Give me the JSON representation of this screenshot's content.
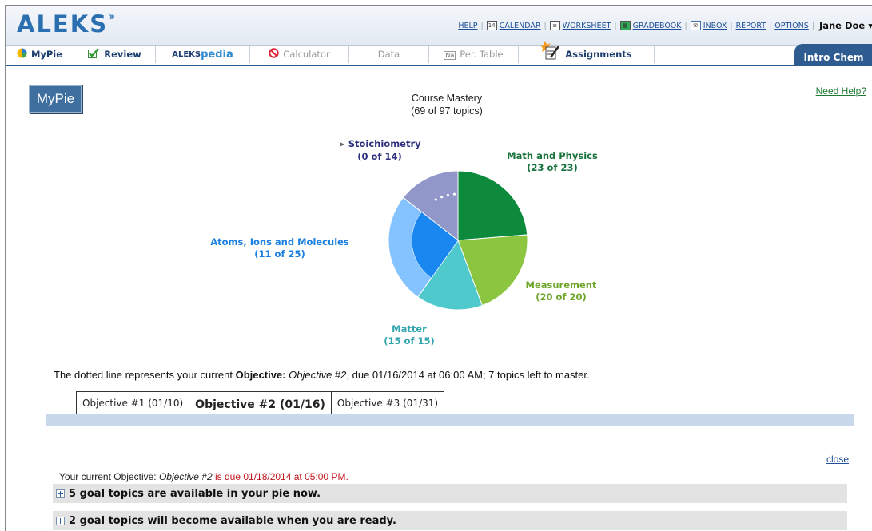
{
  "header": {
    "logo": "ALEKS",
    "logo_mark": "®",
    "links": [
      "HELP",
      "CALENDAR",
      "WORKSHEET",
      "GRADEBOOK",
      "INBOX",
      "REPORT",
      "OPTIONS"
    ],
    "calendar_icon_text": "14",
    "user": "Jane Doe ▾"
  },
  "nav": {
    "tabs": [
      "MyPie",
      "Review",
      "ALEKSpedia",
      "Calculator",
      "Data",
      "Per. Table",
      "Assignments"
    ],
    "pedia_prefix": "ALEKS",
    "pedia_suffix": "pedia",
    "pertable_icon_text": "Na",
    "course": "Intro Chem"
  },
  "main": {
    "mypie_button": "MyPie",
    "mastery_title": "Course Mastery",
    "mastery_sub": "(69 of 97 topics)",
    "need_help": "Need Help?"
  },
  "chart_data": {
    "type": "pie",
    "title": "Course Mastery",
    "subtitle": "(69 of 97 topics)",
    "slices": [
      {
        "name": "Math and Physics",
        "label": "(23 of 23)",
        "mastered": 23,
        "total": 23,
        "color": "#0d8a3c",
        "text_color": "#16713a"
      },
      {
        "name": "Measurement",
        "label": "(20 of 20)",
        "mastered": 20,
        "total": 20,
        "color": "#8cc540",
        "text_color": "#6fa52a"
      },
      {
        "name": "Matter",
        "label": "(15 of 15)",
        "mastered": 15,
        "total": 15,
        "color": "#4fc9cc",
        "text_color": "#32a5ad"
      },
      {
        "name": "Atoms, Ions and Molecules",
        "label": "(11 of 25)",
        "mastered": 11,
        "total": 25,
        "color": "#1a86f0",
        "light_color": "#84c3ff",
        "text_color": "#1a7fe0"
      },
      {
        "name": "Stoichiometry",
        "label": "(0 of 14)",
        "mastered": 0,
        "total": 14,
        "color": "#3d3f8e",
        "light_color": "#9198c9",
        "text_color": "#2f3180"
      }
    ]
  },
  "objective": {
    "line_pre": "The dotted line represents your current ",
    "line_bold": "Objective:",
    "line_italic": "Objective #2",
    "line_post": ", due 01/16/2014 at 06:00 AM; 7 topics left to master.",
    "tabs": [
      "Objective #1 (01/10)",
      "Objective #2 (01/16)",
      "Objective #3 (01/31)"
    ],
    "active_tab": 1,
    "close": "close",
    "current_pre": "Your current Objective: ",
    "current_italic": "Objective #2",
    "current_due": " is due 01/18/2014 at 05:00 PM.",
    "goal_available": "5 goal topics are available in your pie now.",
    "goal_later": "2 goal topics will become available when you are ready."
  }
}
